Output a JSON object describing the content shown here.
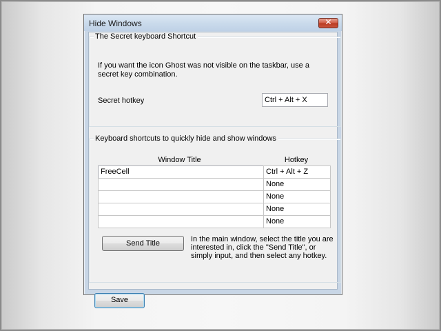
{
  "window": {
    "title": "Hide Windows",
    "close_label": "✕"
  },
  "secret_group": {
    "label": "The Secret keyboard Shortcut",
    "description": "If you want the icon Ghost was not visible on the taskbar, use a secret key combination.",
    "hotkey_label": "Secret hotkey",
    "hotkey_value": "Ctrl + Alt + X"
  },
  "shortcuts_group": {
    "label": "Keyboard shortcuts to quickly hide and show windows",
    "columns": {
      "title": "Window Title",
      "hotkey": "Hotkey"
    },
    "rows": [
      {
        "title": "FreeCell",
        "hotkey": "Ctrl + Alt + Z"
      },
      {
        "title": "",
        "hotkey": "None"
      },
      {
        "title": "",
        "hotkey": "None"
      },
      {
        "title": "",
        "hotkey": "None"
      },
      {
        "title": "",
        "hotkey": "None"
      }
    ],
    "send_title_label": "Send Title",
    "hint": "In the main window, select the title you are interested in, click the \"Send Title\", or simply input, and then select any hotkey."
  },
  "footer": {
    "save_label": "Save"
  }
}
